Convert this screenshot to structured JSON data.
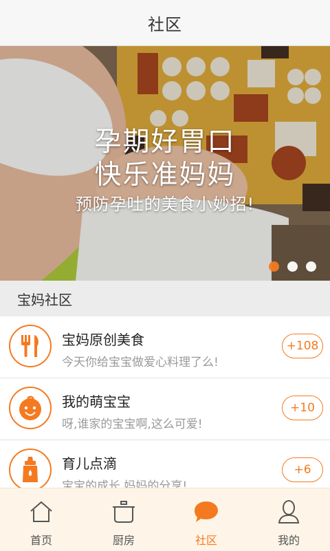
{
  "header": {
    "title": "社区"
  },
  "banner": {
    "line1": "孕期好胃口",
    "line2": "快乐准妈妈",
    "subtitle": "预防孕吐的美食小妙招!",
    "dots": 3,
    "active_dot": 0
  },
  "section": {
    "title": "宝妈社区"
  },
  "list": [
    {
      "name": "宝妈原创美食",
      "desc": "今天你给宝宝做爱心料理了么!",
      "count": "+108",
      "icon": "fork-knife-icon"
    },
    {
      "name": "我的萌宝宝",
      "desc": "呀,谁家的宝宝啊,这么可爱!",
      "count": "+10",
      "icon": "baby-face-icon"
    },
    {
      "name": "育儿点滴",
      "desc": "宝宝的成长,妈妈的分享!",
      "count": "+6",
      "icon": "baby-bottle-icon"
    }
  ],
  "tabbar": {
    "tabs": [
      {
        "label": "首页",
        "icon": "home-icon"
      },
      {
        "label": "厨房",
        "icon": "pot-icon"
      },
      {
        "label": "社区",
        "icon": "chat-bubble-icon",
        "active": true
      },
      {
        "label": "我的",
        "icon": "user-icon"
      }
    ]
  },
  "colors": {
    "accent": "#f47a20",
    "tabbar_bg": "#fef5e8"
  }
}
